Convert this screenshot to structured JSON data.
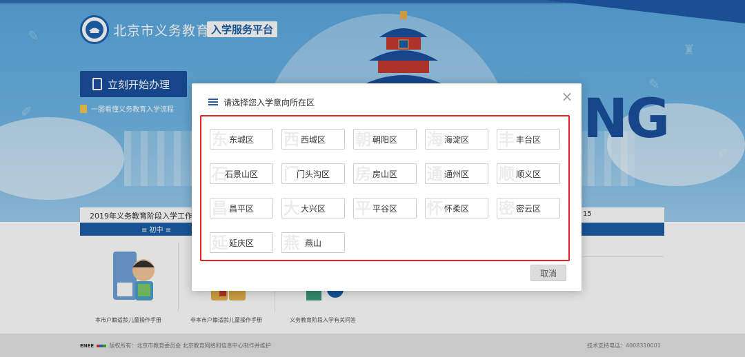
{
  "header": {
    "site_name": "北京市义务教育",
    "site_badge": "入学服务平台",
    "start_button": "立刻开始办理",
    "flow_link": "一图看懂义务教育入学流程",
    "banner_word": "NG",
    "accent_color": "#1d5ea8"
  },
  "notice": {
    "text": "2019年义务教育阶段入学工作时间",
    "right_text": "15"
  },
  "tabs": {
    "junior": "≡ 初中 ≡"
  },
  "guides": [
    {
      "caption": "本市户籍适龄儿童操作手册"
    },
    {
      "caption": "非本市户籍适龄儿童操作手册"
    },
    {
      "caption": "义务教育阶段入学有关问答"
    }
  ],
  "footer": {
    "mini_logo": "ENEE",
    "copyright": "版权所有：北京市教育委员会 北京教育网络和信息中心制作并维护",
    "support": "技术支持电话：4008310001"
  },
  "dialog": {
    "title": "请选择您入学意向所在区",
    "cancel": "取消",
    "close_icon": "close-icon",
    "frame_color": "#e02424",
    "districts": [
      {
        "label": "东城区",
        "wm": "东"
      },
      {
        "label": "西城区",
        "wm": "西"
      },
      {
        "label": "朝阳区",
        "wm": "朝"
      },
      {
        "label": "海淀区",
        "wm": "海"
      },
      {
        "label": "丰台区",
        "wm": "丰"
      },
      {
        "label": "石景山区",
        "wm": "石"
      },
      {
        "label": "门头沟区",
        "wm": "门"
      },
      {
        "label": "房山区",
        "wm": "房"
      },
      {
        "label": "通州区",
        "wm": "通"
      },
      {
        "label": "顺义区",
        "wm": "顺"
      },
      {
        "label": "昌平区",
        "wm": "昌"
      },
      {
        "label": "大兴区",
        "wm": "大"
      },
      {
        "label": "平谷区",
        "wm": "平"
      },
      {
        "label": "怀柔区",
        "wm": "怀"
      },
      {
        "label": "密云区",
        "wm": "密"
      },
      {
        "label": "延庆区",
        "wm": "延"
      },
      {
        "label": "燕山",
        "wm": "燕"
      }
    ]
  }
}
